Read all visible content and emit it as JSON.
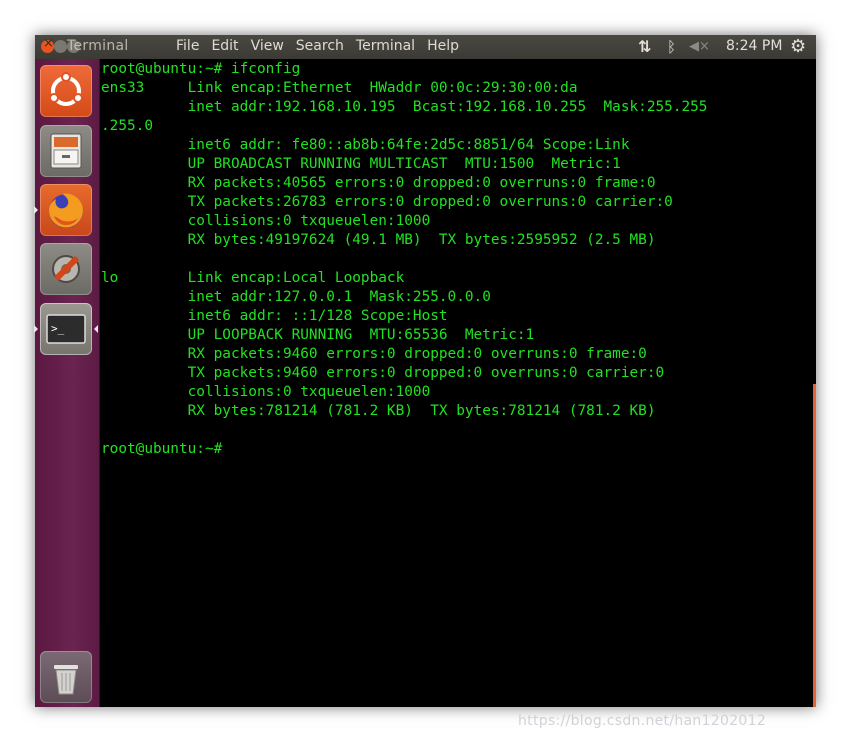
{
  "topbar": {
    "app_title": "Terminal",
    "menus": [
      "File",
      "Edit",
      "View",
      "Search",
      "Terminal",
      "Help"
    ],
    "clock": "8:24 PM",
    "icons": [
      "network-icon",
      "bluetooth-icon",
      "volume-muted-icon",
      "gear-icon"
    ]
  },
  "launcher": {
    "items": [
      "ubuntu-dash",
      "files",
      "firefox",
      "system-settings",
      "terminal",
      "trash"
    ],
    "active": "terminal"
  },
  "terminal": {
    "lines": [
      "root@ubuntu:~# ifconfig",
      "ens33     Link encap:Ethernet  HWaddr 00:0c:29:30:00:da",
      "          inet addr:192.168.10.195  Bcast:192.168.10.255  Mask:255.255",
      ".255.0",
      "          inet6 addr: fe80::ab8b:64fe:2d5c:8851/64 Scope:Link",
      "          UP BROADCAST RUNNING MULTICAST  MTU:1500  Metric:1",
      "          RX packets:40565 errors:0 dropped:0 overruns:0 frame:0",
      "          TX packets:26783 errors:0 dropped:0 overruns:0 carrier:0",
      "          collisions:0 txqueuelen:1000",
      "          RX bytes:49197624 (49.1 MB)  TX bytes:2595952 (2.5 MB)",
      "",
      "lo        Link encap:Local Loopback",
      "          inet addr:127.0.0.1  Mask:255.0.0.0",
      "          inet6 addr: ::1/128 Scope:Host",
      "          UP LOOPBACK RUNNING  MTU:65536  Metric:1",
      "          RX packets:9460 errors:0 dropped:0 overruns:0 frame:0",
      "          TX packets:9460 errors:0 dropped:0 overruns:0 carrier:0",
      "          collisions:0 txqueuelen:1000",
      "          RX bytes:781214 (781.2 KB)  TX bytes:781214 (781.2 KB)",
      "",
      "root@ubuntu:~#"
    ],
    "text_color": "#22e022",
    "background": "#000000"
  },
  "watermark": "https://blog.csdn.net/han1202012"
}
